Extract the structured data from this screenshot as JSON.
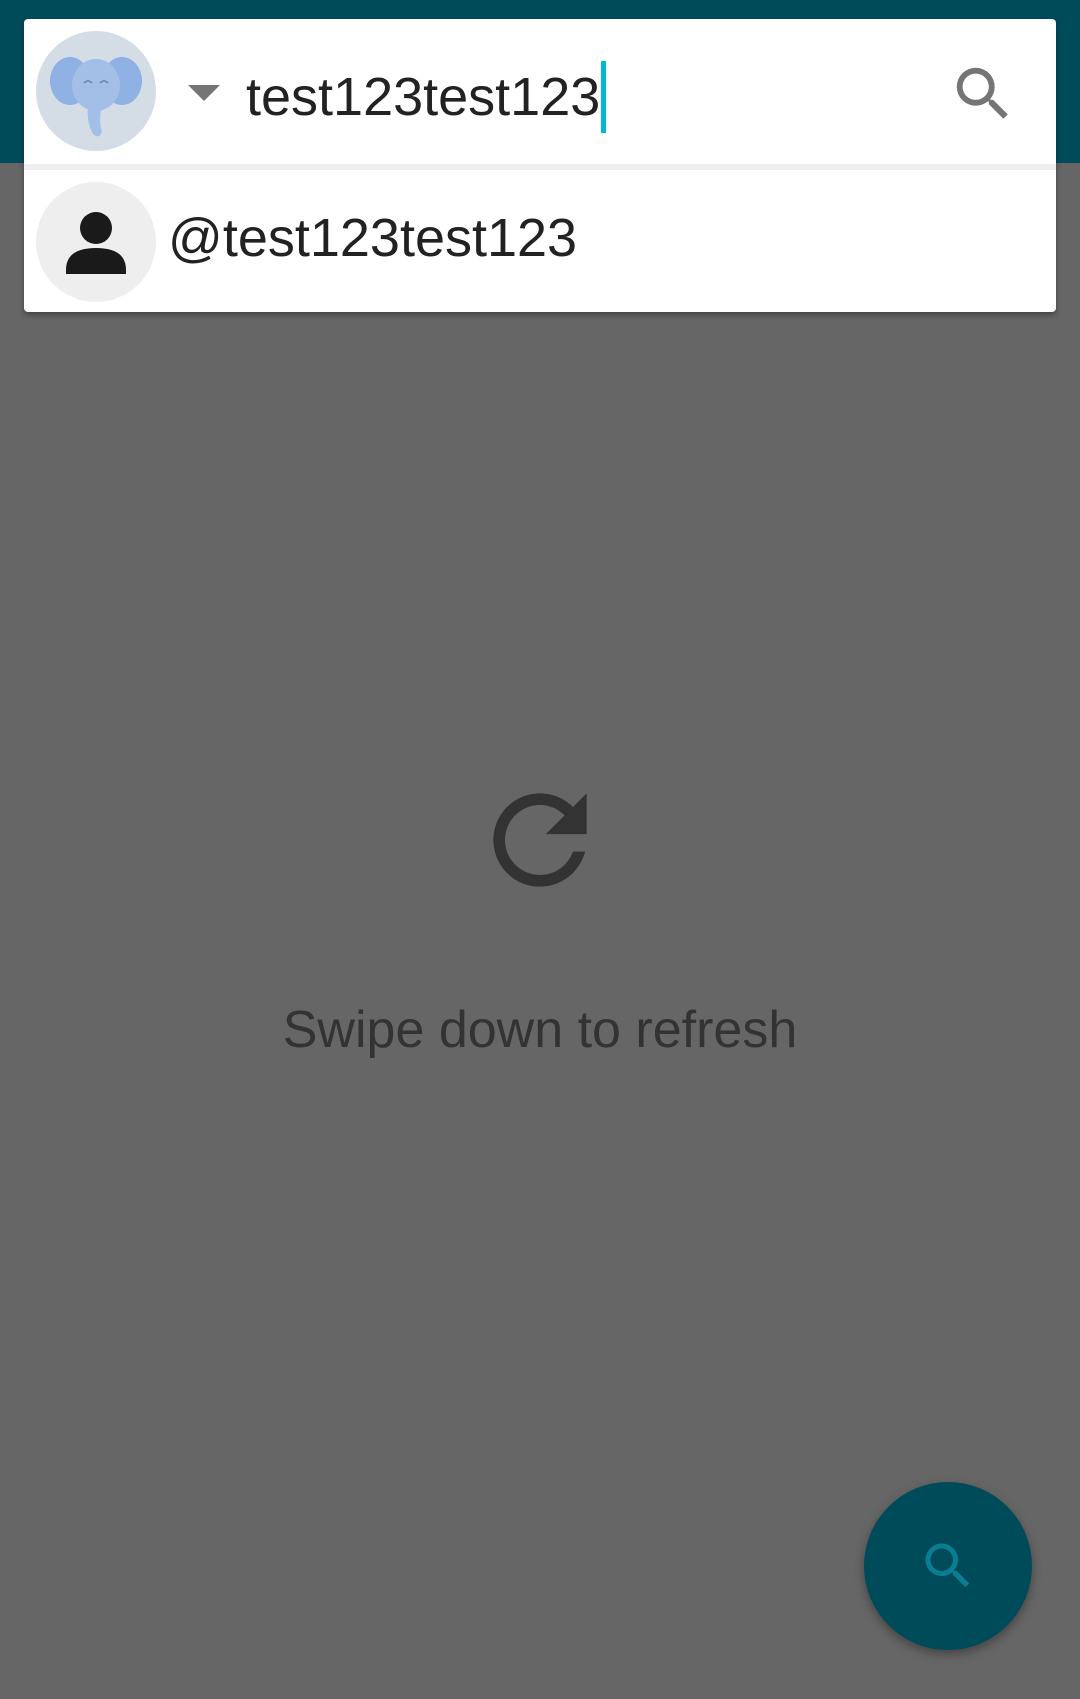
{
  "colors": {
    "topbar": "#004b5a",
    "scrim": "#666666",
    "card": "#ffffff",
    "caret": "#00b8d4",
    "fab": "#004b5a",
    "text": "#222222",
    "empty_text": "#333333"
  },
  "search": {
    "account_avatar_icon": "elephant-mascot-icon",
    "dropdown_icon": "arrow-drop-down-icon",
    "query": "test123test123",
    "submit_icon": "search-icon"
  },
  "suggestions": [
    {
      "icon": "person-icon",
      "label": "@test123test123"
    }
  ],
  "empty_state": {
    "icon": "refresh-icon",
    "message": "Swipe down to refresh"
  },
  "fab": {
    "icon": "search-icon"
  }
}
